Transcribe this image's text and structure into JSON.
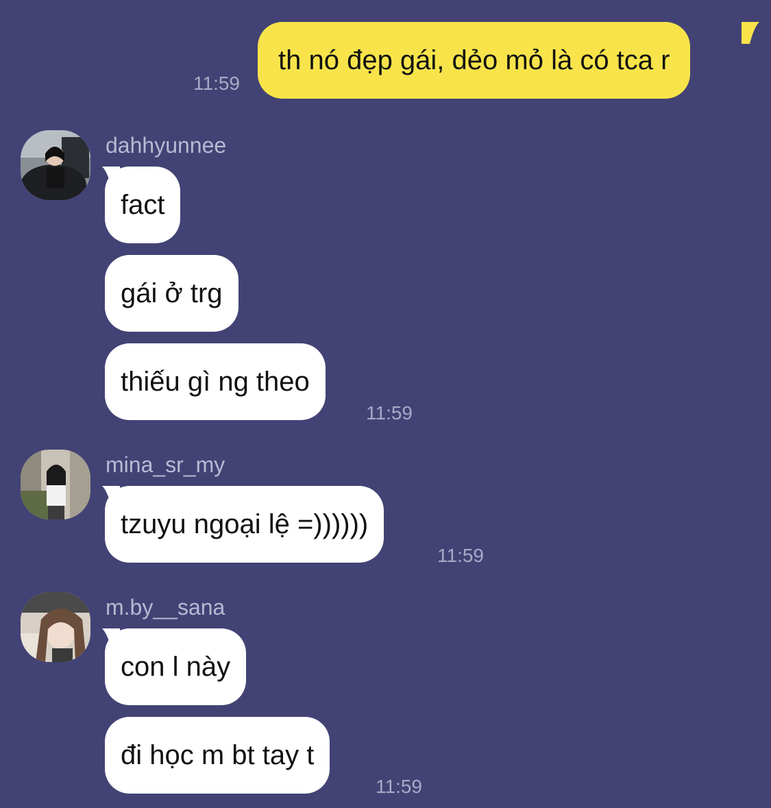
{
  "theme": {
    "background": "#424374",
    "outgoing_bubble": "#f8e44a",
    "incoming_bubble": "#ffffff",
    "timestamp_color": "#a9a9c8",
    "sender_color": "#b9b9d4"
  },
  "messages": {
    "outgoing": {
      "text": "th nó đẹp gái, dẻo mỏ là có tca r",
      "time": "11:59"
    },
    "group1": {
      "sender": "dahhyunnee",
      "avatar_icon": "avatar-photo-icon",
      "bubbles": [
        "fact",
        "gái ở trg",
        "thiếu gì ng theo"
      ],
      "time": "11:59"
    },
    "group2": {
      "sender": "mina_sr_my",
      "avatar_icon": "avatar-photo-icon",
      "bubbles": [
        "tzuyu ngoại lệ =))))))"
      ],
      "time": "11:59"
    },
    "group3": {
      "sender": "m.by__sana",
      "avatar_icon": "avatar-photo-icon",
      "bubbles": [
        "con l này",
        "đi học m bt tay t"
      ],
      "time": "11:59"
    }
  }
}
